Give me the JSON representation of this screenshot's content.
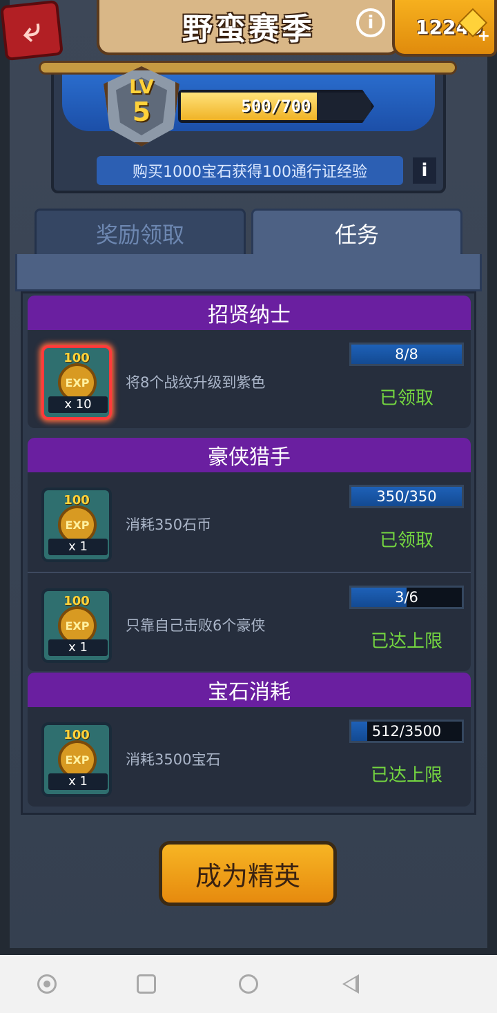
{
  "header": {
    "title": "野蛮赛季",
    "gems": "12249",
    "gem_plus": "+"
  },
  "level": {
    "lv_label": "LV",
    "lv_number": "5",
    "xp_current": 500,
    "xp_max": 700,
    "xp_text": "500/700",
    "xp_fraction": 0.714,
    "promo_text": "购买1000宝石获得100通行证经验",
    "promo_info": "i"
  },
  "tabs": [
    {
      "label": "奖励领取",
      "active": false
    },
    {
      "label": "任务",
      "active": true
    }
  ],
  "sections": [
    {
      "title": "招贤纳士",
      "tasks": [
        {
          "reward_value": "100",
          "reward_coin": "EXP",
          "reward_qty": "x 10",
          "desc": "将8个战纹升级到紫色",
          "progress_text": "8/8",
          "progress_fraction": 1.0,
          "status": "已领取",
          "highlight": true
        }
      ]
    },
    {
      "title": "豪侠猎手",
      "tasks": [
        {
          "reward_value": "100",
          "reward_coin": "EXP",
          "reward_qty": "x 1",
          "desc": "消耗350石币",
          "progress_text": "350/350",
          "progress_fraction": 1.0,
          "status": "已领取",
          "highlight": false
        },
        {
          "reward_value": "100",
          "reward_coin": "EXP",
          "reward_qty": "x 1",
          "desc": "只靠自己击败6个豪侠",
          "progress_text": "3/6",
          "progress_fraction": 0.5,
          "status": "已达上限",
          "highlight": false
        }
      ]
    },
    {
      "title": "宝石消耗",
      "tasks": [
        {
          "reward_value": "100",
          "reward_coin": "EXP",
          "reward_qty": "x 1",
          "desc": "消耗3500宝石",
          "progress_text": "512/3500",
          "progress_fraction": 0.146,
          "status": "已达上限",
          "highlight": false
        }
      ]
    }
  ],
  "cta_label": "成为精英",
  "icons": {
    "back": "back-arrow-icon",
    "info": "info-circle-icon",
    "gem": "gem-icon",
    "nav": [
      "nav-dot-icon",
      "nav-recents-icon",
      "nav-home-icon",
      "nav-back-icon"
    ]
  },
  "colors": {
    "section_header": "#6a1fa0",
    "status_green": "#74d640",
    "progress_blue": "#1e61b8",
    "cta_orange": "#f7b524",
    "back_red": "#b21f24"
  }
}
